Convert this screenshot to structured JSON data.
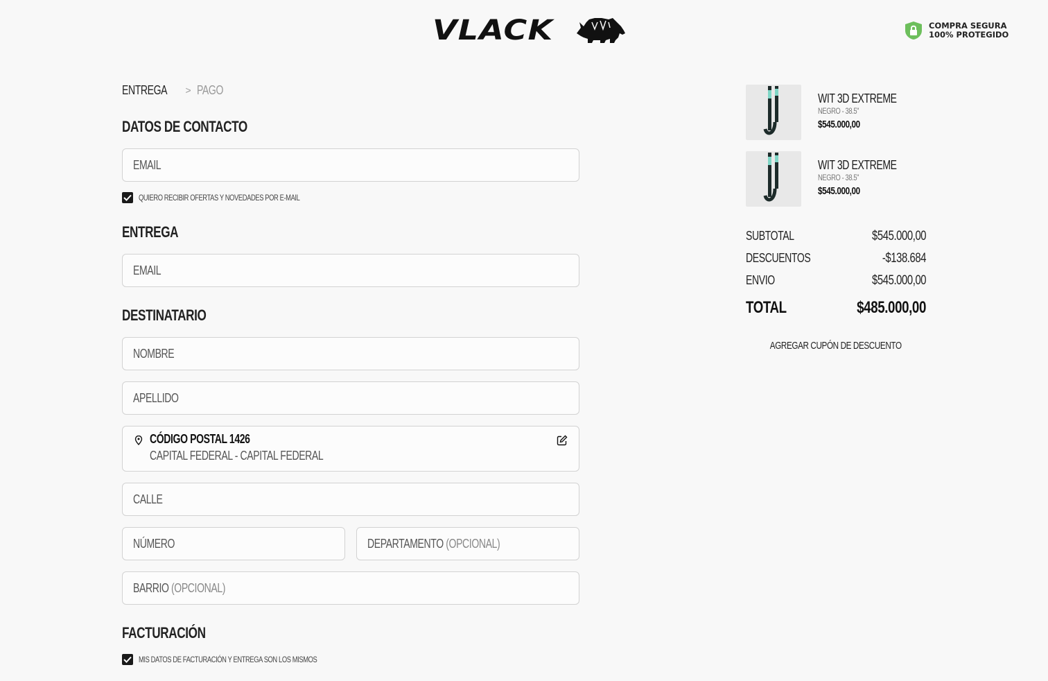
{
  "header": {
    "logo_text": "VLACK",
    "secure_line1": "COMPRA SEGURA",
    "secure_line2": "100% PROTEGIDO"
  },
  "breadcrumb": {
    "step1": "ENTREGA",
    "separator": ">",
    "step2": "PAGO"
  },
  "contact": {
    "title": "DATOS DE CONTACTO",
    "email_placeholder": "EMAIL",
    "newsletter_label": "QUIERO RECIBIR OFERTAS Y NOVEDADES POR E-MAIL"
  },
  "delivery": {
    "title": "ENTREGA",
    "email_placeholder": "EMAIL"
  },
  "recipient": {
    "title": "DESTINATARIO",
    "first_name_placeholder": "NOMBRE",
    "last_name_placeholder": "APELLIDO",
    "postal_title": "CÓDIGO POSTAL 1426",
    "postal_sub": "CAPITAL FEDERAL - CAPITAL FEDERAL",
    "street_placeholder": "CALLE",
    "number_placeholder": "NÚMERO",
    "apartment_label": "DEPARTAMENTO",
    "apartment_optional": "(OPCIONAL)",
    "neighborhood_label": "BARRIO",
    "neighborhood_optional": "(OPCIONAL)"
  },
  "billing": {
    "title": "FACTURACIÓN",
    "same_data_label": "MIS DATOS DE FACTURACIÓN Y ENTREGA SON LOS MISMOS"
  },
  "cart": {
    "items": [
      {
        "name": "WIT 3D EXTREME",
        "variant": "NEGRO - 38.5\"",
        "price": "$545.000,00"
      },
      {
        "name": "WIT 3D EXTREME",
        "variant": "NEGRO - 38.5\"",
        "price": "$545.000,00"
      }
    ],
    "subtotal_label": "SUBTOTAL",
    "subtotal_value": "$545.000,00",
    "discounts_label": "DESCUENTOS",
    "discounts_value": "-$138.684",
    "shipping_label": "ENVIO",
    "shipping_value": "$545.000,00",
    "total_label": "TOTAL",
    "total_value": "$485.000,00",
    "coupon_label": "AGREGAR CUPÓN DE DESCUENTO"
  },
  "colors": {
    "background": "#f8f8f8",
    "text": "#1a1a1a",
    "border": "#d2d2d2",
    "secure_badge": "#6dbf5c",
    "stick_accent": "#7fd6c6"
  }
}
